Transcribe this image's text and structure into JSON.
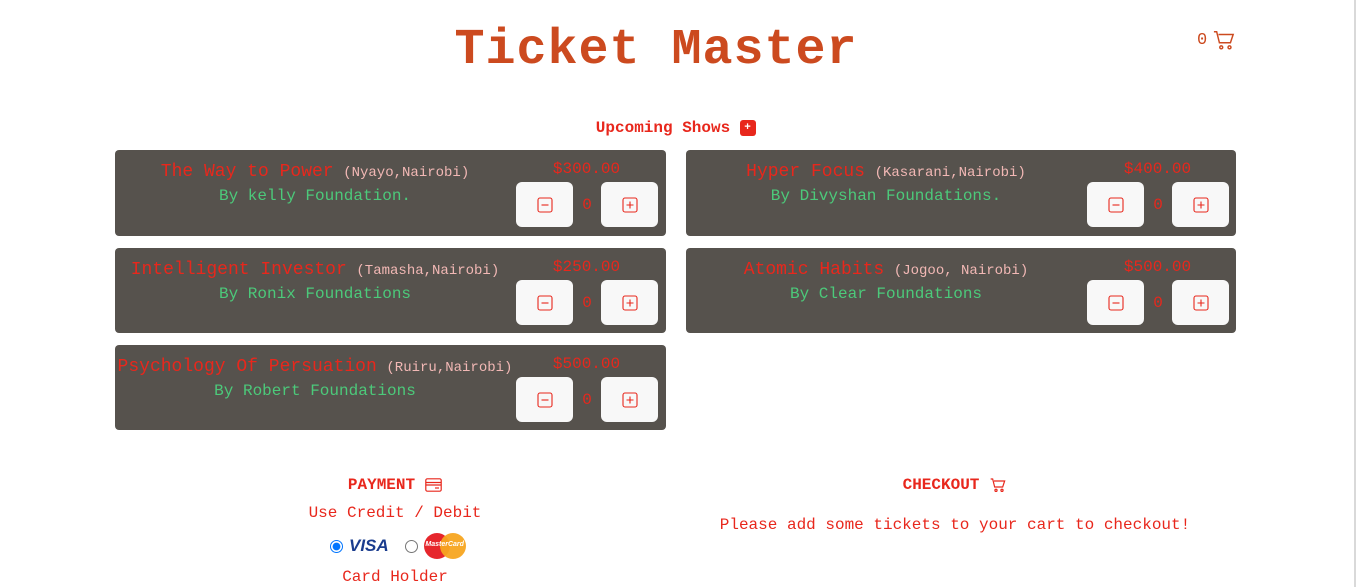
{
  "app": {
    "title": "Ticket Master"
  },
  "cart": {
    "count": "0",
    "icon": "cart-icon"
  },
  "shows_section": {
    "heading": "Upcoming Shows",
    "icon": "calendar-plus-icon"
  },
  "shows": [
    {
      "title": "The Way to Power",
      "venue": "(Nyayo,Nairobi)",
      "organizer": "By kelly Foundation.",
      "price": "$300.00",
      "quantity": "0"
    },
    {
      "title": "Hyper Focus",
      "venue": "(Kasarani,Nairobi)",
      "organizer": "By Divyshan Foundations.",
      "price": "$400.00",
      "quantity": "0"
    },
    {
      "title": "Intelligent Investor",
      "venue": "(Tamasha,Nairobi)",
      "organizer": "By Ronix Foundations",
      "price": "$250.00",
      "quantity": "0"
    },
    {
      "title": "Atomic Habits",
      "venue": "(Jogoo, Nairobi)",
      "organizer": "By Clear Foundations",
      "price": "$500.00",
      "quantity": "0"
    },
    {
      "title": "Psychology Of Persuation",
      "venue": "(Ruiru,Nairobi)",
      "organizer": "By Robert Foundations",
      "price": "$500.00",
      "quantity": "0"
    }
  ],
  "payment": {
    "heading": "PAYMENT",
    "subheading": "Use Credit / Debit",
    "options": [
      {
        "label": "VISA",
        "selected": true
      },
      {
        "label": "MasterCard",
        "selected": false
      }
    ],
    "card_holder_label": "Card Holder"
  },
  "checkout": {
    "heading": "CHECKOUT",
    "message": "Please add some tickets to your cart to checkout!"
  },
  "colors": {
    "accent": "#e8271c",
    "title": "#cc4a1f",
    "card_bg": "#56524d",
    "organizer": "#4cc97a",
    "venue": "#f2b8b5"
  }
}
